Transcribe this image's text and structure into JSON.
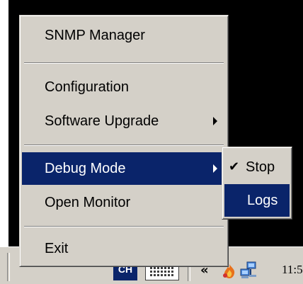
{
  "context_menu": {
    "items": [
      {
        "label": "SNMP Manager"
      },
      {
        "label": "Configuration"
      },
      {
        "label": "Software Upgrade",
        "has_submenu": true
      },
      {
        "label": "Debug Mode",
        "has_submenu": true,
        "highlighted": true
      },
      {
        "label": "Open Monitor"
      },
      {
        "label": "Exit"
      }
    ]
  },
  "debug_submenu": {
    "items": [
      {
        "label": "Stop",
        "checked": true,
        "check_glyph": "✔"
      },
      {
        "label": "Logs",
        "highlighted": true
      }
    ]
  },
  "taskbar": {
    "language_indicator": "CH",
    "tray_overflow_glyph": "«",
    "clock": "11:5"
  },
  "icons": {
    "keyboard": "keyboard-icon",
    "flame": "flame-tray-icon",
    "network": "network-tray-icon",
    "chevron": "chevron-right-icon",
    "check": "checkmark-icon"
  },
  "colors": {
    "menu_background": "#d4d0c8",
    "highlight": "#0a246a",
    "highlight_text": "#ffffff",
    "desktop": "#000000"
  }
}
